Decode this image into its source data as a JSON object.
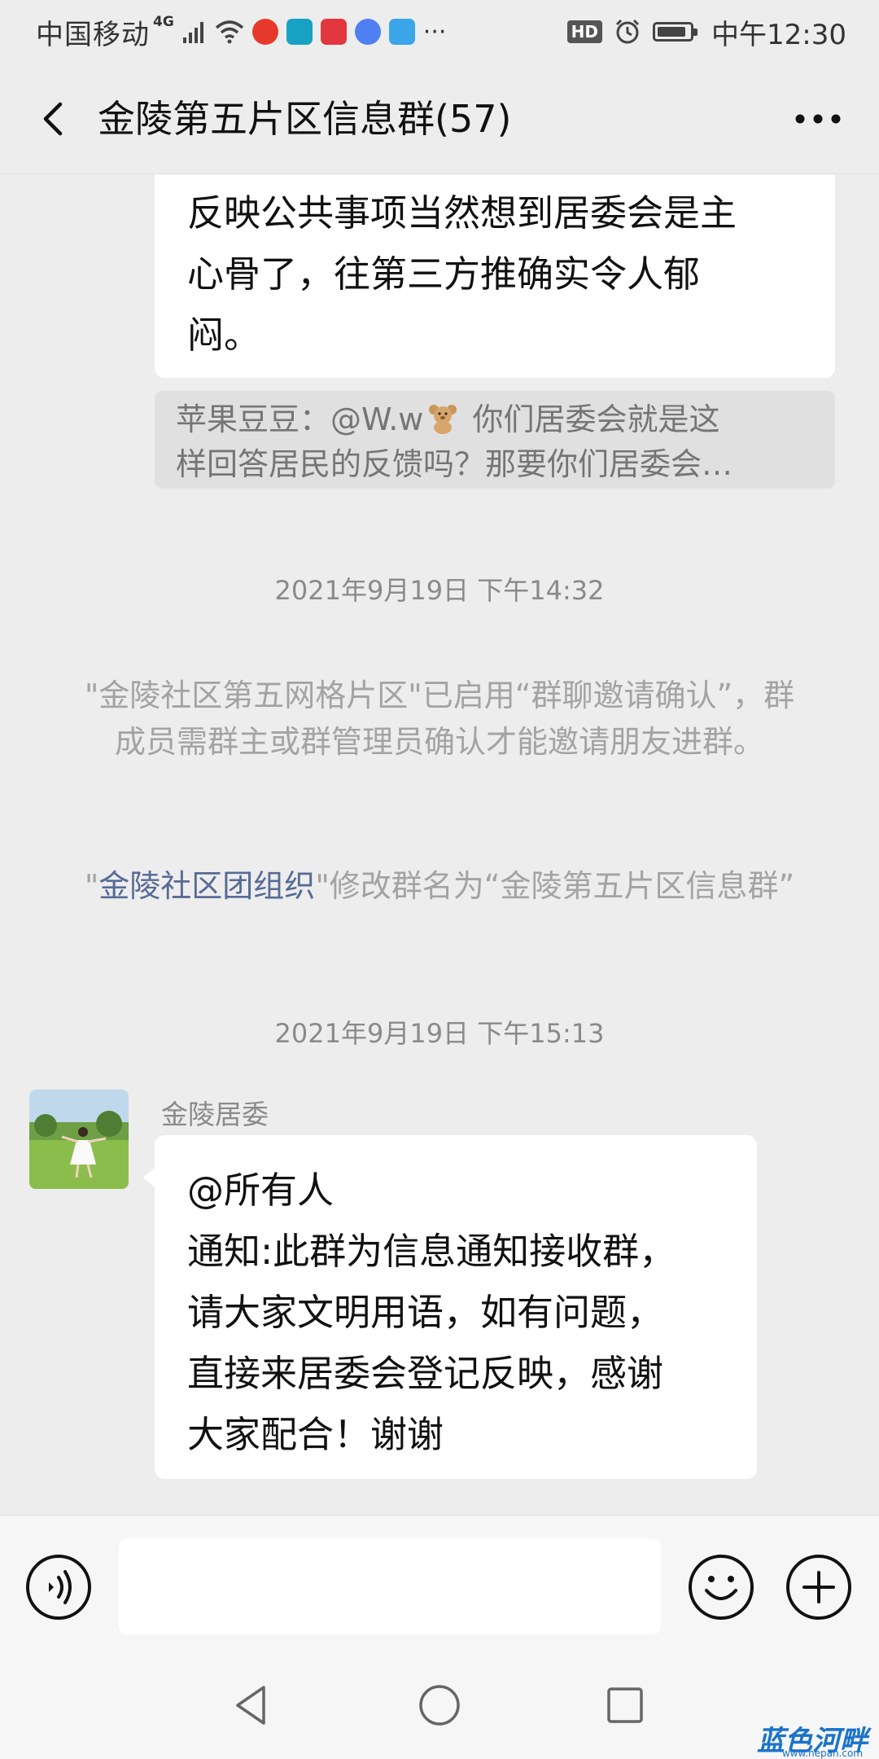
{
  "status_bar": {
    "carrier": "中国移动",
    "network": "4G",
    "hd": "HD",
    "time": "中午12:30"
  },
  "header": {
    "title": "金陵第五片区信息群(57)"
  },
  "messages": {
    "top_bubble": {
      "lines": [
        "反映公共事项当然想到居委会是主",
        "心骨了，往第三方推确实令人郁",
        "闷。"
      ]
    },
    "quote": {
      "prefix": "苹果豆豆：@W.w",
      "line1_rest": " 你们居委会就是这",
      "line2": "样回答居民的反馈吗？那要你们居委会…"
    },
    "timestamp1": "2021年9月19日 下午14:32",
    "system1": "\"金陵社区第五网格片区\"已启用“群聊邀请确认”，群成员需群主或群管理员确认才能邀请朋友进群。",
    "system2": {
      "open_quote": "\"",
      "link": "金陵社区团组织",
      "rest": "\"修改群名为“金陵第五片区信息群”"
    },
    "timestamp2": "2021年9月19日 下午15:13",
    "sender": "金陵居委",
    "main_bubble": {
      "lines": [
        "@所有人",
        "通知:此群为信息通知接收群，",
        "请大家文明用语，如有问题，",
        "直接来居委会登记反映，感谢",
        "大家配合！谢谢"
      ]
    }
  },
  "watermark": {
    "brand": "蓝色河畔",
    "url": "www.hepan.com"
  },
  "colors": {
    "background": "#ededed",
    "bubble": "#ffffff",
    "link": "#576b95",
    "system_text": "#a3a3a3"
  }
}
